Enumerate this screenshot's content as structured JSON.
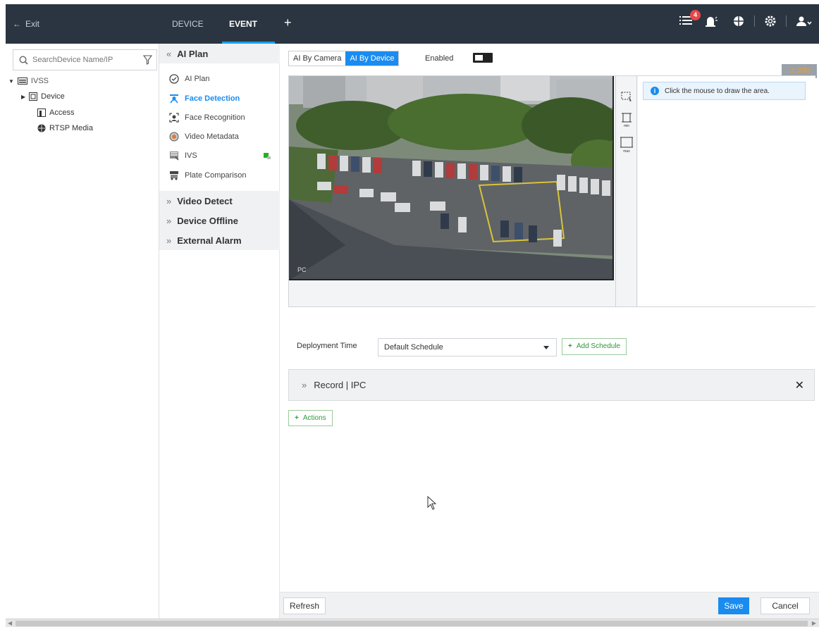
{
  "topbar": {
    "exit_label": "Exit",
    "tabs": [
      {
        "label": "DEVICE"
      },
      {
        "label": "EVENT"
      }
    ],
    "add_tab": "+",
    "alarm_count": "4"
  },
  "tree": {
    "search_placeholder": "SearchDevice Name/IP",
    "root": "IVSS",
    "items": [
      {
        "label": "Device"
      },
      {
        "label": "Access"
      },
      {
        "label": "RTSP Media"
      }
    ]
  },
  "menu": {
    "ai_plan_section": "AI Plan",
    "items": [
      {
        "label": "AI Plan"
      },
      {
        "label": "Face Detection"
      },
      {
        "label": "Face Recognition"
      },
      {
        "label": "Video Metadata"
      },
      {
        "label": "IVS"
      },
      {
        "label": "Plate Comparison"
      }
    ],
    "sections": [
      {
        "label": "Video Detect"
      },
      {
        "label": "Device Offline"
      },
      {
        "label": "External Alarm"
      }
    ]
  },
  "content": {
    "mode_tabs": [
      {
        "label": "AI By Camera"
      },
      {
        "label": "AI By Device"
      }
    ],
    "enabled_label": "Enabled",
    "warning": "200",
    "video_label": "PC",
    "tool_labels": {
      "min": "min",
      "max": "max"
    },
    "info_text": "Click the mouse to draw the area.",
    "deployment_label": "Deployment Time",
    "schedule_value": "Default Schedule",
    "add_schedule": "Add Schedule",
    "record_label": "Record | IPC",
    "actions_label": "Actions"
  },
  "footer": {
    "refresh": "Refresh",
    "save": "Save",
    "cancel": "Cancel"
  },
  "colors": {
    "accent": "#1a8cf0",
    "topbar": "#2b3541",
    "green": "#2d9a3c",
    "badge": "#e8474a"
  }
}
